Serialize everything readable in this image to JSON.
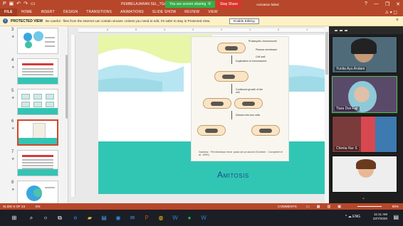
{
  "titlebar": {
    "title": "PEMBELAJARAN SEL_TGA...",
    "share_status": "You are screen sharing",
    "stop_share": "Stop Share",
    "activation": "Activation failed",
    "help": "?",
    "minimize": "—",
    "restore": "❐",
    "close": "✕"
  },
  "ribbon": {
    "tabs": [
      "FILE",
      "HOME",
      "INSERT",
      "DESIGN",
      "TRANSITIONS",
      "ANIMATIONS",
      "SLIDE SHOW",
      "REVIEW",
      "VIEW"
    ]
  },
  "protected_view": {
    "title": "PROTECTED VIEW",
    "message": "Be careful - files from the Internet can contain viruses. Unless you need to edit, it's safer to stay in Protected View.",
    "button": "Enable Editing",
    "close": "×"
  },
  "slides_panel": {
    "numbers": [
      "3",
      "4",
      "5",
      "6",
      "7",
      "8"
    ],
    "selected_index": 3
  },
  "slide": {
    "title": "Amitosis",
    "diagram_labels": {
      "prokaryotic": "Prokaryotic chromosome",
      "membrane": "Plasma membrane",
      "wall": "Cell wall",
      "duplication": "Duplication of chromosome",
      "growth": "Continued growth of the cell",
      "division": "Division into two cells"
    },
    "caption": "Gambar : Pembelahan biner pada sel prokariot (Sumber : Campbell et al. 1999)"
  },
  "zoom": {
    "participants": [
      "Yunita Ayu Andani",
      "Tiara Dwi Fajr",
      "Chintia Nur S"
    ]
  },
  "status_bar": {
    "slide_info": "SLIDE 6 OF 23",
    "language": "EN",
    "comments": "COMMENTS",
    "zoom_level": "96%"
  },
  "taskbar": {
    "time": "11:11 AM",
    "date": "10/7/2020",
    "tray": "^ ☁ ENG"
  },
  "colors": {
    "brand": "#b7472a",
    "teal": "#31c6b4",
    "share_green": "#2fb14a",
    "stop_red": "#d9342b"
  }
}
